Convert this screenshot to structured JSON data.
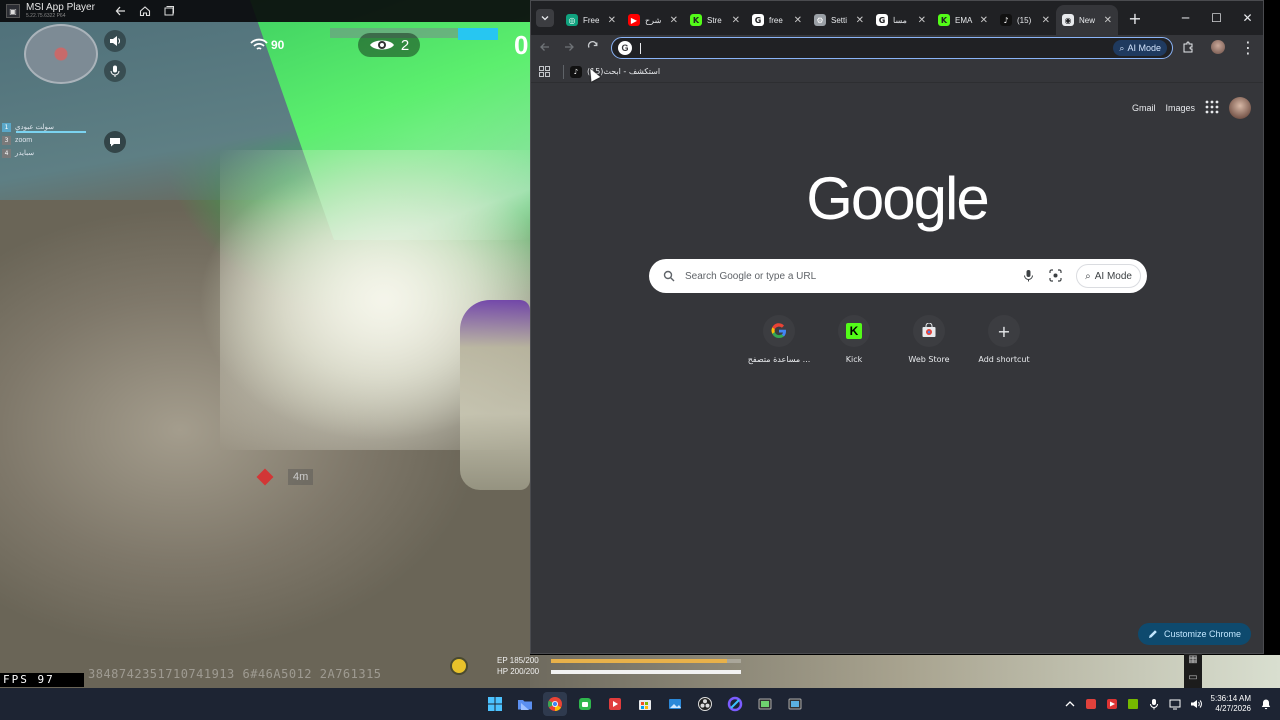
{
  "emulator": {
    "title": "MSI App Player",
    "version": "5.22.75.6322 P64"
  },
  "game": {
    "ping": "90",
    "spectators": "2",
    "score_partial": "0",
    "distance": "4m",
    "fps_label": "FPS 97",
    "watermark": "3848742351710741913 6#46A5012 2A761315",
    "team": [
      {
        "num": "1",
        "name": "سولت عبودي"
      },
      {
        "num": "3",
        "name": "zoom"
      },
      {
        "num": "4",
        "name": "سبايدر"
      }
    ],
    "ep": "EP 185/200",
    "hp": "HP 200/200",
    "ep_fraction": 0.925,
    "hp_fraction": 1.0
  },
  "chrome": {
    "tabs": [
      {
        "title": "Free",
        "favicon": "chatgpt-icon",
        "color": "#10a37f",
        "glyph": "◎"
      },
      {
        "title": "شرح",
        "favicon": "youtube-icon",
        "color": "#ff0000",
        "glyph": "▶"
      },
      {
        "title": "Stre",
        "favicon": "kick-icon",
        "color": "#53fc18",
        "glyph": "K"
      },
      {
        "title": "free",
        "favicon": "google-icon",
        "color": "#ffffff",
        "glyph": "G"
      },
      {
        "title": "Setti",
        "favicon": "settings-icon",
        "color": "#9aa0a6",
        "glyph": "⚙"
      },
      {
        "title": "مسا",
        "favicon": "google-icon",
        "color": "#ffffff",
        "glyph": "G"
      },
      {
        "title": "EMA",
        "favicon": "kick-icon",
        "color": "#53fc18",
        "glyph": "K"
      },
      {
        "title": "(15)",
        "favicon": "tiktok-icon",
        "color": "#111111",
        "glyph": "♪"
      },
      {
        "title": "New",
        "favicon": "chrome-icon",
        "color": "#e8eaed",
        "glyph": "◉",
        "active": true
      }
    ],
    "omnibox_value": "",
    "ai_mode_label": "AI Mode",
    "bookmark": {
      "title": "(15)استكشف - ابحث",
      "favicon": "tiktok-icon"
    },
    "ntp": {
      "gmail": "Gmail",
      "images": "Images",
      "logo": "Google",
      "search_placeholder": "Search Google or type a URL",
      "ai_mode_label": "AI Mode",
      "shortcuts": [
        {
          "label": "مساعدة متصفح ...",
          "icon": "google-icon"
        },
        {
          "label": "Kick",
          "icon": "kick-icon"
        },
        {
          "label": "Web Store",
          "icon": "web-store-icon"
        },
        {
          "label": "Add shortcut",
          "icon": "plus-icon"
        }
      ],
      "customize_label": "Customize Chrome"
    }
  },
  "taskbar": {
    "time": "5:36:14 AM",
    "date": "4/27/2026"
  }
}
